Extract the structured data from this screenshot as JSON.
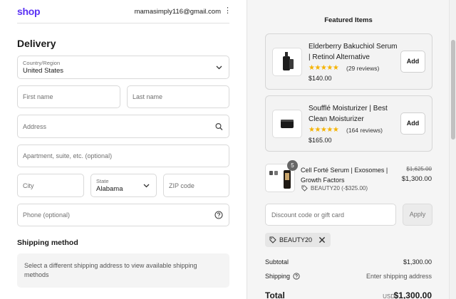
{
  "header": {
    "logo": "shop",
    "email": "mamasimply116@gmail.com",
    "menu_glyph": "⋮"
  },
  "delivery": {
    "title": "Delivery",
    "country": {
      "label": "Country/Region",
      "value": "United States"
    },
    "first_name_placeholder": "First name",
    "last_name_placeholder": "Last name",
    "address_placeholder": "Address",
    "apartment_placeholder": "Apartment, suite, etc. (optional)",
    "city_placeholder": "City",
    "state": {
      "label": "State",
      "value": "Alabama"
    },
    "zip_placeholder": "ZIP code",
    "phone_placeholder": "Phone (optional)"
  },
  "shipping": {
    "title": "Shipping method",
    "note": "Select a different shipping address to view available shipping methods"
  },
  "featured": {
    "title": "Featured Items",
    "items": [
      {
        "title": "Elderberry Bakuchiol Serum | Retinol Alternative",
        "stars": "★★★★★",
        "rating": 4.5,
        "reviews": "(29 reviews)",
        "price": "$140.00",
        "add_label": "Add"
      },
      {
        "title": "Soufflé Moisturizer | Best Clean Moisturizer",
        "stars": "★★★★★",
        "rating": 5,
        "reviews": "(164 reviews)",
        "price": "$165.00",
        "add_label": "Add"
      }
    ]
  },
  "cart": {
    "line": {
      "quantity": "5",
      "title": "Cell Forté Serum | Exosomes | Growth Factors",
      "discount": "BEAUTY20 (-$325.00)",
      "original_price": "$1,625.00",
      "price": "$1,300.00"
    },
    "discount_placeholder": "Discount code or gift card",
    "apply_label": "Apply",
    "applied_code": "BEAUTY20"
  },
  "summary": {
    "subtotal_label": "Subtotal",
    "subtotal_value": "$1,300.00",
    "shipping_label": "Shipping",
    "shipping_value": "Enter shipping address",
    "total_label": "Total",
    "currency": "USD",
    "total_value": "$1,300.00"
  },
  "colors": {
    "brand": "#5a31f4",
    "star": "#f5b301",
    "sidebar_bg": "#f5f5f5"
  },
  "icons": [
    "chevron-down-icon",
    "search-icon",
    "help-circle-icon",
    "tag-icon",
    "close-icon",
    "kebab-menu-icon"
  ]
}
